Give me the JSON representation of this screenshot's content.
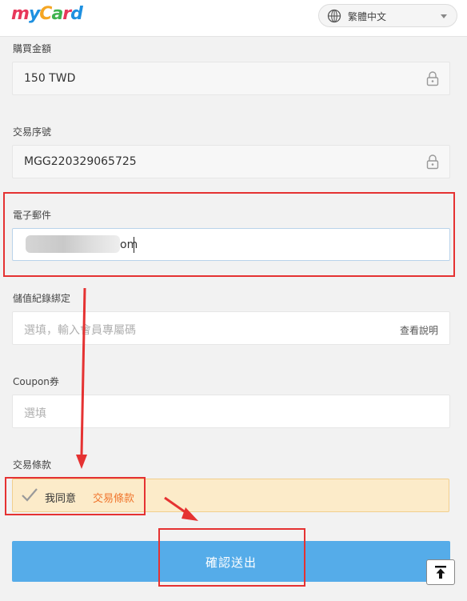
{
  "header": {
    "logo": {
      "m": "m",
      "y": "y",
      "c": "C",
      "a": "a",
      "r": "r",
      "d": "d"
    },
    "language": {
      "selected": "繁體中文",
      "icon": "globe-icon"
    }
  },
  "form": {
    "amount": {
      "label": "購買金額",
      "value": "150 TWD",
      "icon": "lock-icon"
    },
    "order": {
      "label": "交易序號",
      "value": "MGG220329065725",
      "icon": "lock-icon"
    },
    "email": {
      "label": "電子郵件",
      "value_visible_tail": "om"
    },
    "binding": {
      "label": "儲值紀錄綁定",
      "placeholder": "選填，輸入會員專屬碼",
      "help": "查看說明"
    },
    "coupon": {
      "label": "Coupon券",
      "placeholder": "選填"
    },
    "terms": {
      "label": "交易條款",
      "agree": "我同意",
      "link": "交易條款",
      "icon": "check-icon"
    }
  },
  "actions": {
    "submit": "確認送出",
    "back_to_top_icon": "back-to-top-icon"
  },
  "colors": {
    "accent": "#55ace9",
    "annotation": "#e53232",
    "terms_bg": "#fcebc9",
    "link": "#f0762e"
  }
}
